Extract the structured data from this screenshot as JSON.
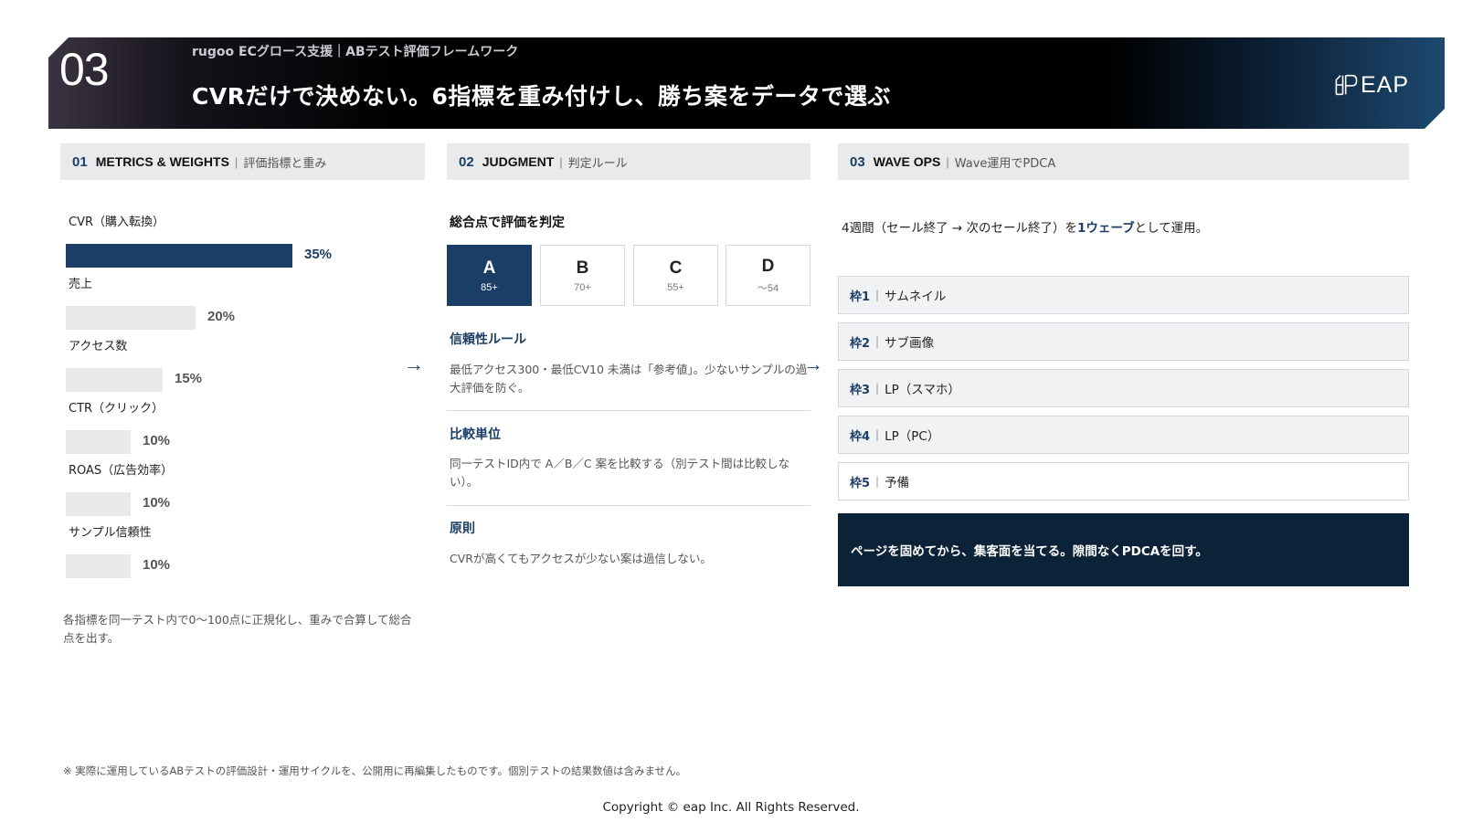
{
  "header": {
    "number": "03",
    "subtitle": "rugoo ECグロース支援｜ABテスト評価フレームワーク",
    "title": "CVRだけで決めない。6指標を重み付けし、勝ち案をデータで選ぶ",
    "logo_text": "EAP"
  },
  "sections": [
    {
      "num": "01",
      "en": "METRICS & WEIGHTS",
      "ja": "評価指標と重み"
    },
    {
      "num": "02",
      "en": "JUDGMENT",
      "ja": "判定ルール"
    },
    {
      "num": "03",
      "en": "WAVE OPS",
      "ja": "Wave運用でPDCA"
    }
  ],
  "metrics": [
    {
      "label": "CVR（購入転換）",
      "value": "35%",
      "weight": 35
    },
    {
      "label": "売上",
      "value": "20%",
      "weight": 20
    },
    {
      "label": "アクセス数",
      "value": "15%",
      "weight": 15
    },
    {
      "label": "CTR（クリック）",
      "value": "10%",
      "weight": 10
    },
    {
      "label": "ROAS（広告効率）",
      "value": "10%",
      "weight": 10
    },
    {
      "label": "サンプル信頼性",
      "value": "10%",
      "weight": 10
    }
  ],
  "metrics_note": "各指標を同一テスト内で0〜100点に正規化し、重みで合算して総合点を出す。",
  "judgment": {
    "title": "総合点で評価を判定",
    "grades": [
      {
        "grade": "A",
        "range": "85+"
      },
      {
        "grade": "B",
        "range": "70+"
      },
      {
        "grade": "C",
        "range": "55+"
      },
      {
        "grade": "D",
        "range": "〜54"
      }
    ],
    "rules": [
      {
        "heading": "信頼性ルール",
        "text": "最低アクセス300・最低CV10 未満は「参考値」。少ないサンプルの過大評価を防ぐ。"
      },
      {
        "heading": "比較単位",
        "text": "同一テストID内で A／B／C 案を比較する（別テスト間は比較しない）。"
      },
      {
        "heading": "原則",
        "text": "CVRが高くてもアクセスが少ない案は過信しない。"
      }
    ]
  },
  "wave": {
    "intro_before": "4週間（セール終了 → 次のセール終了）を",
    "intro_highlight": "1ウェーブ",
    "intro_after": "として運用。",
    "slots": [
      {
        "key": "枠1",
        "value": "サムネイル"
      },
      {
        "key": "枠2",
        "value": "サブ画像"
      },
      {
        "key": "枠3",
        "value": "LP（スマホ）"
      },
      {
        "key": "枠4",
        "value": "LP（PC）"
      },
      {
        "key": "枠5",
        "value": "予備"
      }
    ],
    "summary": "ページを固めてから、集客面を当てる。隙間なくPDCAを回す。"
  },
  "arrows": {
    "a1": "→",
    "a2": "→"
  },
  "separator": "|",
  "footnote": "※ 実際に運用しているABテストの評価設計・運用サイクルを、公開用に再編集したものです。個別テストの結果数値は含みません。",
  "copyright": "Copyright © eap Inc. All Rights Reserved.",
  "colors": {
    "accent": "#1a3e66",
    "dark_box": "#0c2238",
    "panel": "#e8eaec"
  }
}
